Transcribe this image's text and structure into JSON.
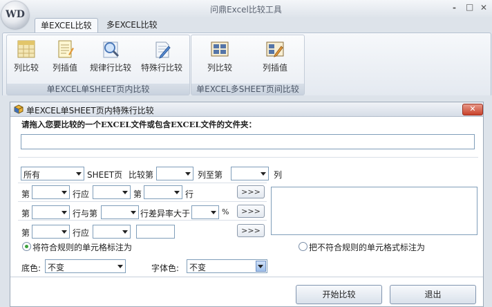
{
  "window": {
    "title": "问鼎Excel比较工具",
    "logo_text": "WD",
    "controls": {
      "minimize": "-",
      "maximize": "□",
      "close": "✕"
    }
  },
  "tabs": [
    {
      "label": "单EXCEL比较",
      "active": true
    },
    {
      "label": "多EXCEL比较",
      "active": false
    }
  ],
  "ribbon": {
    "group1": {
      "label": "单EXCEL单SHEET页内比较",
      "buttons": [
        {
          "label": "列比较",
          "icon": "grid-icon"
        },
        {
          "label": "列插值",
          "icon": "notepad-icon"
        },
        {
          "label": "规律行比较",
          "icon": "magnifier-icon"
        },
        {
          "label": "特殊行比较",
          "icon": "document-pencil-icon"
        }
      ]
    },
    "group2": {
      "label": "单EXCEL多SHEET页间比较",
      "buttons": [
        {
          "label": "列比较",
          "icon": "table-icon"
        },
        {
          "label": "列插值",
          "icon": "table-pencil-icon"
        }
      ]
    }
  },
  "panel": {
    "title": "单EXCEL单SHEET页内特殊行比较",
    "close_label": "✕",
    "prompt": "请拖入您要比较的一个EXCEL文件或包含EXCEL文件的文件夹：",
    "file_path": "",
    "row1": {
      "sheet_select": "所有",
      "sheet_label": "SHEET页",
      "compare_label": "比较第",
      "from_col": "",
      "to_label": "列至第",
      "to_col": "",
      "col_label": "列"
    },
    "row2": {
      "label_a": "第",
      "row_no": "",
      "label_b": "行应",
      "relation": "",
      "label_c": "第",
      "other_row": "",
      "label_d": "行",
      "go": ">>>"
    },
    "row3": {
      "label_a": "第",
      "row_no": "",
      "label_b": "行与第",
      "other_row": "",
      "label_c": "行差异率大于",
      "rate": "",
      "label_d": "%",
      "go": ">>>"
    },
    "row4": {
      "label_a": "第",
      "row_no": "",
      "label_b": "行应",
      "relation": "",
      "value": "",
      "go": ">>>"
    },
    "rules_list": [],
    "mark_match": {
      "label": "将符合规则的单元格标注为",
      "checked": true
    },
    "mark_nonmatch": {
      "label": "把不符合规则的单元格式标注为",
      "checked": false
    },
    "bg_color": {
      "label": "底色:",
      "value": "不变"
    },
    "font_color": {
      "label": "字体色:",
      "value": "不变"
    },
    "start_button": "开始比较",
    "exit_button": "退出"
  },
  "colors": {
    "accent": "#3aa13a",
    "close_red": "#c8412b",
    "ribbon_label_bg": "#c9d2de"
  }
}
